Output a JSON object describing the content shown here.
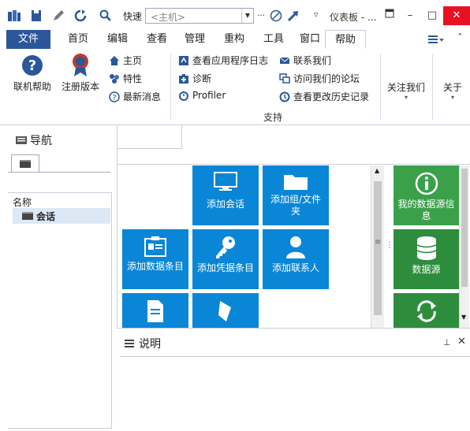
{
  "quick_access": {
    "quick_label": "快速",
    "host_placeholder": "<主机>",
    "title_text": "仪表板 - ..."
  },
  "tabs": [
    {
      "label": "文件"
    },
    {
      "label": "首页"
    },
    {
      "label": "编辑"
    },
    {
      "label": "查看"
    },
    {
      "label": "管理"
    },
    {
      "label": "重构"
    },
    {
      "label": "工具"
    },
    {
      "label": "窗口"
    },
    {
      "label": "帮助"
    }
  ],
  "ribbon": {
    "contact_help": "联机帮助",
    "register": "注册版本",
    "home": "主页",
    "features": "特性",
    "latest": "最新消息",
    "view_log": "查看应用程序日志",
    "diagnose": "诊断",
    "profiler": "Profiler",
    "contact_us": "联系我们",
    "forum": "访问我们的论坛",
    "history": "查看更改历史记录",
    "follow": "关注我们",
    "about": "关于",
    "group_support": "支持"
  },
  "nav": {
    "title": "导航",
    "column_header": "名称",
    "session": "会话"
  },
  "tiles": {
    "add_session": "添加会话",
    "add_group": "添加组/文件夹",
    "add_data_entry": "添加数据条目",
    "add_credential": "添加凭据条目",
    "add_contact": "添加联系人",
    "my_datasource_info": "我的数据源信息",
    "datasource": "数据源"
  },
  "description": {
    "title": "说明"
  },
  "colors": {
    "accent": "#2b579a",
    "tile_blue": "#0a86d6",
    "tile_green": "#2e8d3c",
    "close_red": "#e81123"
  }
}
